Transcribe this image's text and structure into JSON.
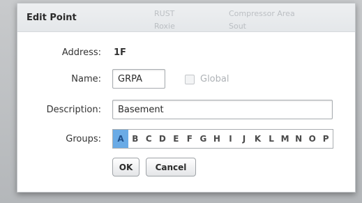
{
  "dialog": {
    "title": "Edit Point"
  },
  "form": {
    "address_label": "Address:",
    "address_value": "1F",
    "name_label": "Name:",
    "name_value": "GRPA",
    "global_label": "Global",
    "description_label": "Description:",
    "description_value": "Basement",
    "groups_label": "Groups:",
    "groups": [
      "A",
      "B",
      "C",
      "D",
      "E",
      "F",
      "G",
      "H",
      "I",
      "J",
      "K",
      "L",
      "M",
      "N",
      "O",
      "P"
    ],
    "selected_group": "A"
  },
  "buttons": {
    "ok_label": "OK",
    "cancel_label": "Cancel"
  },
  "background": {
    "rows": [
      "RUST",
      "Compressor Area",
      "Roxie",
      "Sout"
    ]
  },
  "colors": {
    "selected_group_bg": "#6aabe6"
  }
}
